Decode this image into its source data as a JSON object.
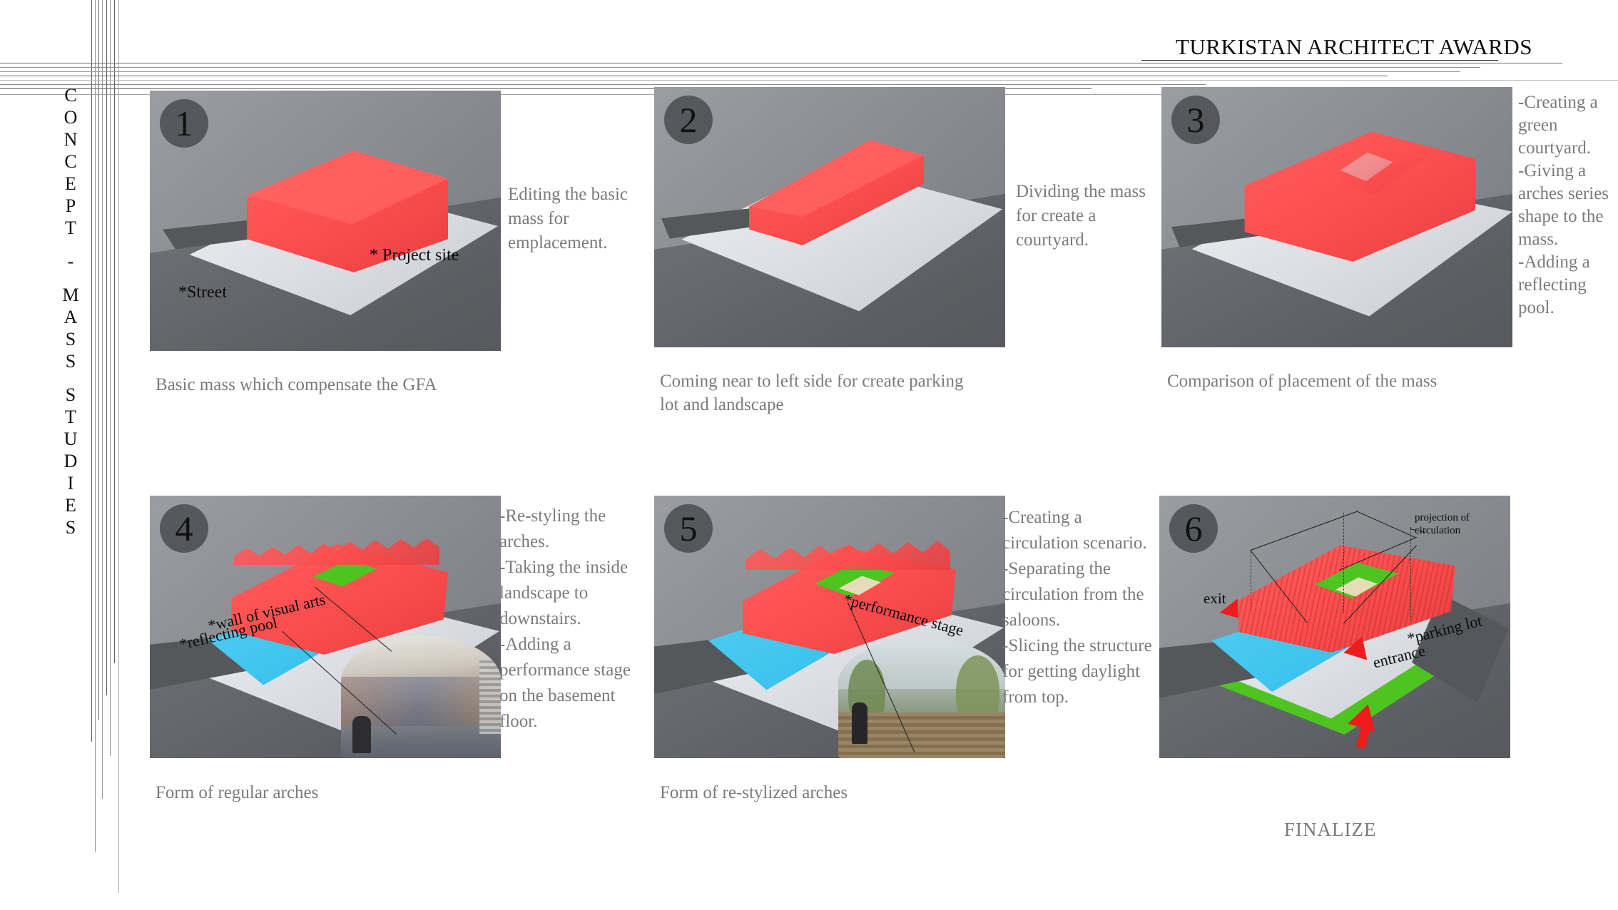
{
  "header": {
    "title": "TURKISTAN ARCHITECT AWARDS"
  },
  "side_caption": {
    "text": "CONCEPT - MASS STUDIES",
    "letters": [
      "C",
      "O",
      "N",
      "C",
      "E",
      "P",
      "T",
      "",
      "-",
      "",
      "M",
      "A",
      "S",
      "S",
      "",
      "S",
      "T",
      "U",
      "D",
      "I",
      "E",
      "S"
    ]
  },
  "panels": [
    {
      "number": "1",
      "caption": "Basic mass which compensate the GFA",
      "note": "Editing the basic mass for emplacement.",
      "pins": [
        "* Project site",
        "*Street"
      ]
    },
    {
      "number": "2",
      "caption": "Coming near to left side for create parking lot and landscape",
      "note": "Dividing the mass for create a courtyard.",
      "pins": []
    },
    {
      "number": "3",
      "caption": "Comparison of placement of the mass",
      "note": "-Creating a green courtyard.\n-Giving a arches series shape to the mass.\n-Adding a reflecting pool.",
      "pins": []
    },
    {
      "number": "4",
      "caption": "Form of regular arches",
      "note": "-Re-styling the arches.\n-Taking the inside landscape to downstairs.\n-Adding a performance stage on the basement floor.",
      "pins": [
        "*wall of visual arts",
        "*reflecting pool"
      ]
    },
    {
      "number": "5",
      "caption": "Form of re-stylized arches",
      "note": "-Creating a circulation scenario.\n-Separating the circulation from the saloons.\n-Slicing the structure for getting daylight from top.",
      "pins": [
        "*performance stage"
      ]
    },
    {
      "number": "6",
      "caption": "",
      "note": "",
      "pins": [
        "projection of circulation",
        "exit",
        "entrance",
        "*parking lot"
      ]
    }
  ],
  "footer": {
    "finalize": "FINALIZE"
  },
  "colors": {
    "mass_red": "#fb4d4d",
    "courtyard_green": "#4ec421",
    "pool_cyan": "#31bfec",
    "plate_white": "#e6e8ee",
    "background_gray": "#8b8d92",
    "text_gray": "#7b7b7b",
    "arrow_red": "#ee1c1c"
  }
}
